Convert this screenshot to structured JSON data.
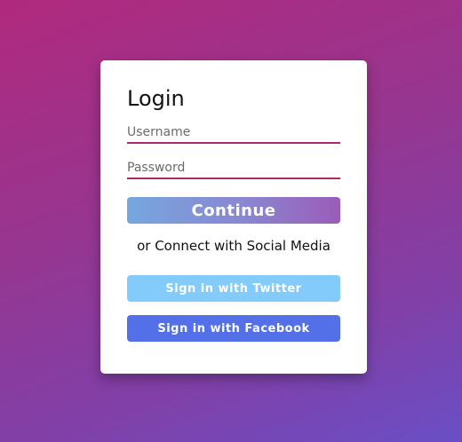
{
  "login": {
    "title": "Login",
    "username_placeholder": "Username",
    "password_placeholder": "Password",
    "continue_label": "Continue",
    "social_text": "or Connect with Social Media",
    "twitter_label": "Sign in with Twitter",
    "facebook_label": "Sign in with Facebook"
  },
  "colors": {
    "background_start": "#b02a7e",
    "background_end": "#6a4fc6",
    "field_underline": "#b02a6b",
    "twitter": "#83cbfb",
    "facebook": "#5470e8"
  }
}
